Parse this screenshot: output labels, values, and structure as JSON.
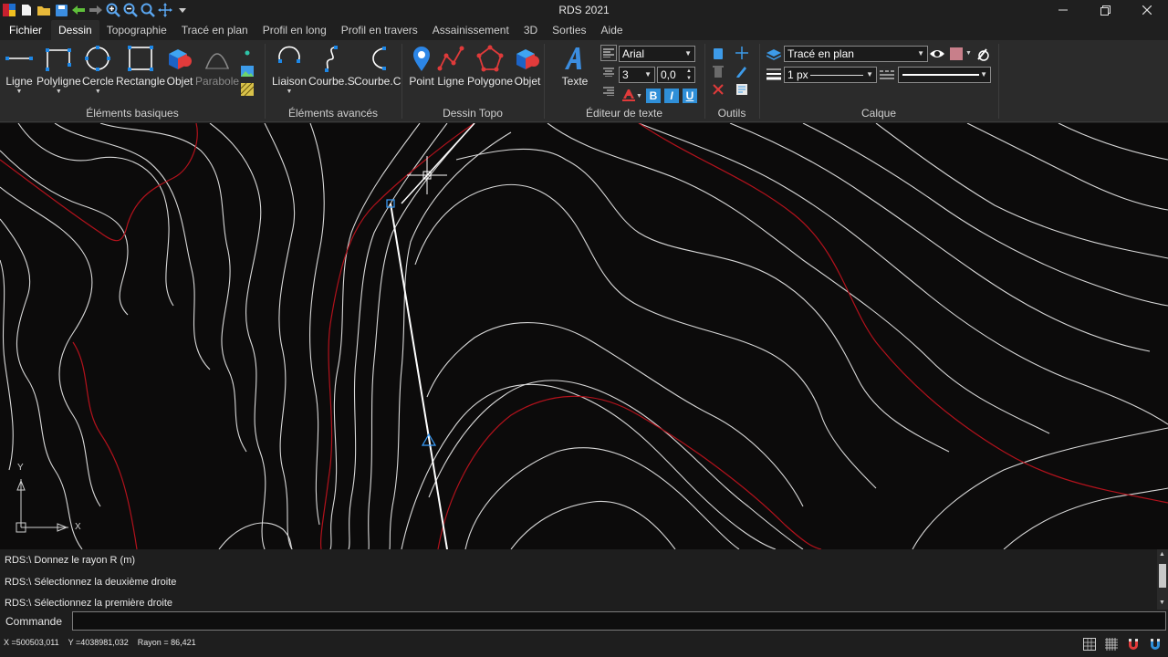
{
  "window": {
    "title": "RDS 2021"
  },
  "tabs": [
    {
      "label": "Fichier"
    },
    {
      "label": "Dessin"
    },
    {
      "label": "Topographie"
    },
    {
      "label": "Tracé en plan"
    },
    {
      "label": "Profil en long"
    },
    {
      "label": "Profil en travers"
    },
    {
      "label": "Assainissement"
    },
    {
      "label": "3D"
    },
    {
      "label": "Sorties"
    },
    {
      "label": "Aide"
    }
  ],
  "ribbon": {
    "basic": {
      "label": "Éléments basiques",
      "tools": [
        "Ligne",
        "Polyligne",
        "Cercle",
        "Rectangle",
        "Objet",
        "Parabole"
      ]
    },
    "advanced": {
      "label": "Éléments avancés",
      "tools": [
        "Liaison",
        "Courbe.S",
        "Courbe.C"
      ]
    },
    "topo": {
      "label": "Dessin Topo",
      "tools": [
        "Point",
        "Ligne",
        "Polygone",
        "Objet"
      ]
    },
    "text_editor": {
      "label": "Éditeur de texte",
      "tool": "Texte",
      "font": "Arial",
      "size": "3",
      "angle": "0,0",
      "bold": "B",
      "italic": "I",
      "underline": "U"
    },
    "tools": {
      "label": "Outils"
    },
    "layer": {
      "label": "Calque",
      "current": "Tracé en plan",
      "color": "#c87f8a",
      "line_width": "1 px"
    }
  },
  "history": [
    "RDS:\\ Donnez le rayon R (m)",
    "RDS:\\ Sélectionnez la deuxième  droite",
    "RDS:\\ Sélectionnez la première droite"
  ],
  "command": {
    "label": "Commande",
    "value": ""
  },
  "status": {
    "x": "X =500503,011",
    "y": "Y =4038981,032",
    "rayon": "Rayon  = 86,421"
  },
  "axes": {
    "x": "X",
    "y": "Y"
  },
  "colors": {
    "contour": "#d8d8d8",
    "contour_major": "#b3121c",
    "canvas": "#0c0b0b",
    "accent": "#2a7fd4"
  }
}
